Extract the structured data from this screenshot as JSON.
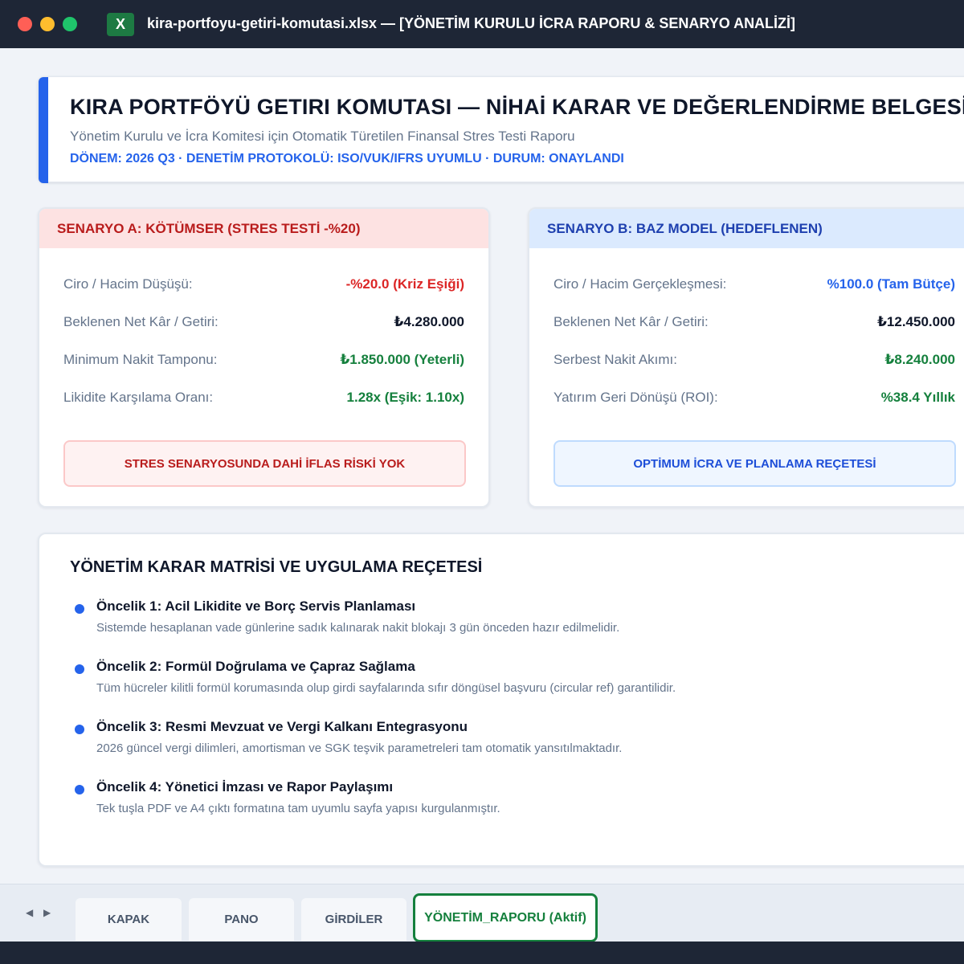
{
  "window": {
    "title": "kira-portfoyu-getiri-komutasi.xlsx — [YÖNETİM KURULU İCRA RAPORU & SENARYO ANALİZİ]",
    "app_icon_label": "X"
  },
  "header": {
    "title": "KIRA PORTFÖYÜ GETIRI KOMUTASI — NİHAİ KARAR VE DEĞERLENDİRME BELGESİ",
    "subtitle": "Yönetim Kurulu ve İcra Komitesi için Otomatik Türetilen Finansal Stres Testi Raporu",
    "meta": "DÖNEM: 2026 Q3 · DENETİM PROTOKOLÜ: ISO/VUK/IFRS UYUMLU · DURUM: ONAYLANDI"
  },
  "scenario_a": {
    "title": "SENARYO A: KÖTÜMSER (STRES TESTİ -%20)",
    "metrics": [
      {
        "label": "Ciro / Hacim Düşüşü:",
        "value": "-%20.0 (Kriz Eşiği)"
      },
      {
        "label": "Beklenen Net Kâr / Getiri:",
        "value": "₺4.280.000"
      },
      {
        "label": "Minimum Nakit Tamponu:",
        "value": "₺1.850.000 (Yeterli)"
      },
      {
        "label": "Likidite Karşılama Oranı:",
        "value": "1.28x (Eşik: 1.10x)"
      }
    ],
    "button": "STRES SENARYOSUNDA DAHİ İFLAS RİSKİ YOK"
  },
  "scenario_b": {
    "title": "SENARYO B: BAZ MODEL (HEDEFLENEN)",
    "metrics": [
      {
        "label": "Ciro / Hacim Gerçekleşmesi:",
        "value": "%100.0 (Tam Bütçe)"
      },
      {
        "label": "Beklenen Net Kâr / Getiri:",
        "value": "₺12.450.000"
      },
      {
        "label": "Serbest Nakit Akımı:",
        "value": "₺8.240.000"
      },
      {
        "label": "Yatırım Geri Dönüşü (ROI):",
        "value": "%38.4 Yıllık"
      }
    ],
    "button": "OPTİMUM İCRA VE PLANLAMA REÇETESİ"
  },
  "matrix": {
    "title": "YÖNETİM KARAR MATRİSİ VE UYGULAMA REÇETESİ",
    "items": [
      {
        "title": "Öncelik 1: Acil Likidite ve Borç Servis Planlaması",
        "desc": "Sistemde hesaplanan vade günlerine sadık kalınarak nakit blokajı 3 gün önceden hazır edilmelidir."
      },
      {
        "title": "Öncelik 2: Formül Doğrulama ve Çapraz Sağlama",
        "desc": "Tüm hücreler kilitli formül korumasında olup girdi sayfalarında sıfır döngüsel başvuru (circular ref) garantilidir."
      },
      {
        "title": "Öncelik 3: Resmi Mevzuat ve Vergi Kalkanı Entegrasyonu",
        "desc": "2026 güncel vergi dilimleri, amortisman ve SGK teşvik parametreleri tam otomatik yansıtılmaktadır."
      },
      {
        "title": "Öncelik 4: Yönetici İmzası ve Rapor Paylaşımı",
        "desc": "Tek tuşla PDF ve A4 çıktı formatına tam uyumlu sayfa yapısı kurgulanmıştır."
      }
    ]
  },
  "sheet_tabs": {
    "prev_icon": "◀",
    "next_icon": "▶",
    "tabs": [
      "KAPAK",
      "PANO",
      "GİRDİLER",
      "YÖNETİM_RAPORU (Aktif)"
    ],
    "active_index": 3
  },
  "colors": {
    "accent": "#2563eb",
    "danger": "#dc2626",
    "success": "#15803d",
    "titlebar": "#1e2636"
  }
}
